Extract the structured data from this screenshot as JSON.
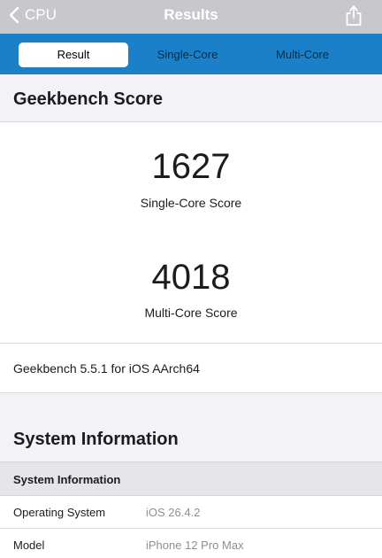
{
  "nav": {
    "back_label": "CPU",
    "title": "Results",
    "back_icon": "chevron-left-icon",
    "share_icon": "share-icon"
  },
  "tabs": [
    {
      "label": "Result",
      "selected": true
    },
    {
      "label": "Single-Core",
      "selected": false
    },
    {
      "label": "Multi-Core",
      "selected": false
    }
  ],
  "score_section": {
    "title": "Geekbench Score",
    "single_core": {
      "value": "1627",
      "label": "Single-Core Score"
    },
    "multi_core": {
      "value": "4018",
      "label": "Multi-Core Score"
    },
    "version": "Geekbench 5.5.1 for iOS AArch64"
  },
  "system_section": {
    "title": "System Information",
    "subheader": "System Information",
    "rows": [
      {
        "key": "Operating System",
        "value": "iOS 26.4.2"
      },
      {
        "key": "Model",
        "value": "iPhone 12 Pro Max"
      }
    ]
  },
  "colors": {
    "nav_bar": "#c7c7cc",
    "segment_bar": "#1b80c7",
    "section_background": "#f2f2f7"
  }
}
